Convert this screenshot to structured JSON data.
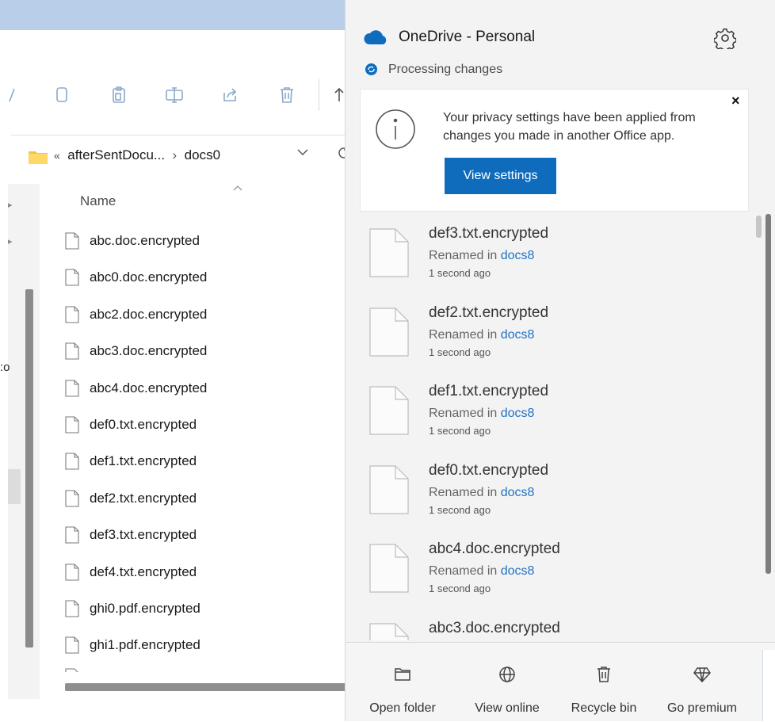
{
  "explorer": {
    "address": {
      "overflow": "«",
      "folder": "afterSentDocu...",
      "separator": "›",
      "current": "docs0"
    },
    "column_header": "Name",
    "left_cut_text": ":o",
    "files": [
      "abc.doc.encrypted",
      "abc0.doc.encrypted",
      "abc2.doc.encrypted",
      "abc3.doc.encrypted",
      "abc4.doc.encrypted",
      "def0.txt.encrypted",
      "def1.txt.encrypted",
      "def2.txt.encrypted",
      "def3.txt.encrypted",
      "def4.txt.encrypted",
      "ghi0.pdf.encrypted",
      "ghi1.pdf.encrypted"
    ]
  },
  "onedrive": {
    "title": "OneDrive - Personal",
    "status": "Processing changes",
    "banner": {
      "message": "Your privacy settings have been applied from changes you made in another Office app.",
      "button": "View settings",
      "close": "×"
    },
    "activity": [
      {
        "name": "def3.txt.encrypted",
        "action": "Renamed in",
        "location": "docs8",
        "time": "1 second ago"
      },
      {
        "name": "def2.txt.encrypted",
        "action": "Renamed in",
        "location": "docs8",
        "time": "1 second ago"
      },
      {
        "name": "def1.txt.encrypted",
        "action": "Renamed in",
        "location": "docs8",
        "time": "1 second ago"
      },
      {
        "name": "def0.txt.encrypted",
        "action": "Renamed in",
        "location": "docs8",
        "time": "1 second ago"
      },
      {
        "name": "abc4.doc.encrypted",
        "action": "Renamed in",
        "location": "docs8",
        "time": "1 second ago"
      },
      {
        "name": "abc3.doc.encrypted",
        "action": "",
        "location": "",
        "time": ""
      }
    ],
    "footer": [
      {
        "label": "Open folder",
        "icon": "folder-icon"
      },
      {
        "label": "View online",
        "icon": "globe-icon"
      },
      {
        "label": "Recycle bin",
        "icon": "trash-icon"
      },
      {
        "label": "Go premium",
        "icon": "diamond-icon"
      }
    ]
  },
  "colors": {
    "accent": "#0f6cbd",
    "link": "#2271c4",
    "flyout_bg": "#f3f3f3",
    "title_strip": "#b9cfe9"
  }
}
